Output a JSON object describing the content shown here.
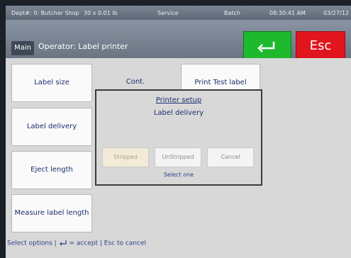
{
  "status": {
    "dept": "Dept#: 0: Butcher Shop",
    "scale": "30 x 0.01 lb",
    "mode": "Service",
    "batch": "Batch",
    "time": "08:30:41 AM",
    "date": "03/27/12"
  },
  "header": {
    "main_label": "Main",
    "operator": "Operator: Label printer",
    "esc_label": "Esc"
  },
  "menu": {
    "label_size": "Label size",
    "label_delivery": "Label delivery",
    "eject_length": "Eject length",
    "measure_label_length": "Measure label length",
    "cont": "Cont.",
    "print_test_label": "Print Test label"
  },
  "dialog": {
    "title": "Printer setup",
    "subtitle": "Label delivery",
    "buttons": {
      "stripped": "Stripped",
      "unstripped": "UnStripped",
      "cancel": "Cancel"
    },
    "hint": "Select one"
  },
  "footer": {
    "text_before": "Select options |",
    "text_after": "= accept | Esc to cancel"
  },
  "colors": {
    "enter_button": "#1fb92e",
    "esc_button": "#e0151d",
    "text_blue": "#1c2e6e"
  }
}
